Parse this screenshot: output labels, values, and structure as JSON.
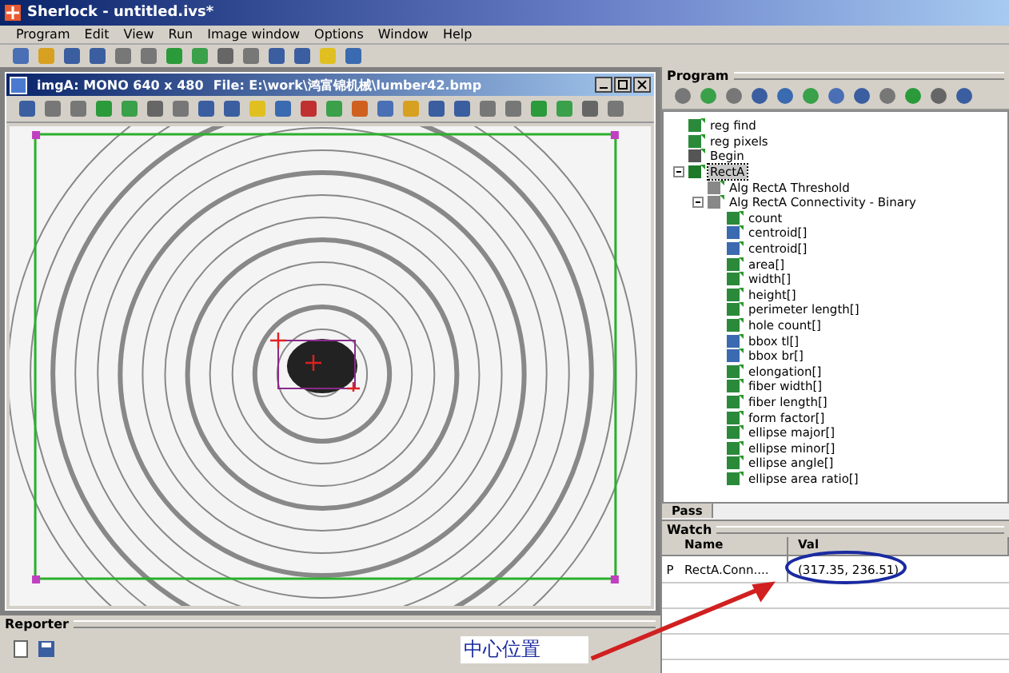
{
  "window": {
    "title": "Sherlock - untitled.ivs*"
  },
  "menu": [
    "Program",
    "Edit",
    "View",
    "Run",
    "Image window",
    "Options",
    "Window",
    "Help"
  ],
  "image_window": {
    "title": "imgA: MONO 640 x 480",
    "file": "File: E:\\work\\鸿富锦机械\\lumber42.bmp"
  },
  "program": {
    "title": "Program",
    "tree": [
      {
        "label": "reg find",
        "kind": "variable",
        "selected": false
      },
      {
        "label": "reg pixels",
        "kind": "variable",
        "selected": false
      },
      {
        "label": "Begin",
        "kind": "marker",
        "selected": false
      },
      {
        "label": "RectA",
        "kind": "roi",
        "selected": true,
        "expanded": true,
        "children": [
          {
            "label": "Alg RectA Threshold",
            "kind": "algorithm",
            "selected": false
          },
          {
            "label": "Alg RectA Connectivity - Binary",
            "kind": "algorithm",
            "selected": false,
            "expanded": true,
            "children": [
              {
                "label": "count",
                "kind": "variable",
                "selected": false
              },
              {
                "label": "centroid[]",
                "kind": "point",
                "selected": false
              },
              {
                "label": "centroid[]",
                "kind": "point",
                "selected": false
              },
              {
                "label": "area[]",
                "kind": "variable",
                "selected": false
              },
              {
                "label": "width[]",
                "kind": "variable",
                "selected": false
              },
              {
                "label": "height[]",
                "kind": "variable",
                "selected": false
              },
              {
                "label": "perimeter length[]",
                "kind": "variable",
                "selected": false
              },
              {
                "label": "hole count[]",
                "kind": "variable",
                "selected": false
              },
              {
                "label": "bbox tl[]",
                "kind": "point",
                "selected": false
              },
              {
                "label": "bbox br[]",
                "kind": "point",
                "selected": false
              },
              {
                "label": "elongation[]",
                "kind": "variable",
                "selected": false
              },
              {
                "label": "fiber width[]",
                "kind": "variable",
                "selected": false
              },
              {
                "label": "fiber length[]",
                "kind": "variable",
                "selected": false
              },
              {
                "label": "form factor[]",
                "kind": "variable",
                "selected": false
              },
              {
                "label": "ellipse major[]",
                "kind": "variable",
                "selected": false
              },
              {
                "label": "ellipse minor[]",
                "kind": "variable",
                "selected": false
              },
              {
                "label": "ellipse angle[]",
                "kind": "variable",
                "selected": false
              },
              {
                "label": "ellipse area ratio[]",
                "kind": "variable",
                "selected": false
              }
            ]
          }
        ]
      }
    ]
  },
  "pass_tab": "Pass",
  "watch": {
    "title": "Watch",
    "columns": [
      "Name",
      "Val"
    ],
    "rows": [
      {
        "marker": "P",
        "name": "RectA.Conn....",
        "value": "(317.35, 236.51)"
      }
    ]
  },
  "reporter": {
    "title": "Reporter"
  },
  "annotation": {
    "label": "中心位置"
  }
}
